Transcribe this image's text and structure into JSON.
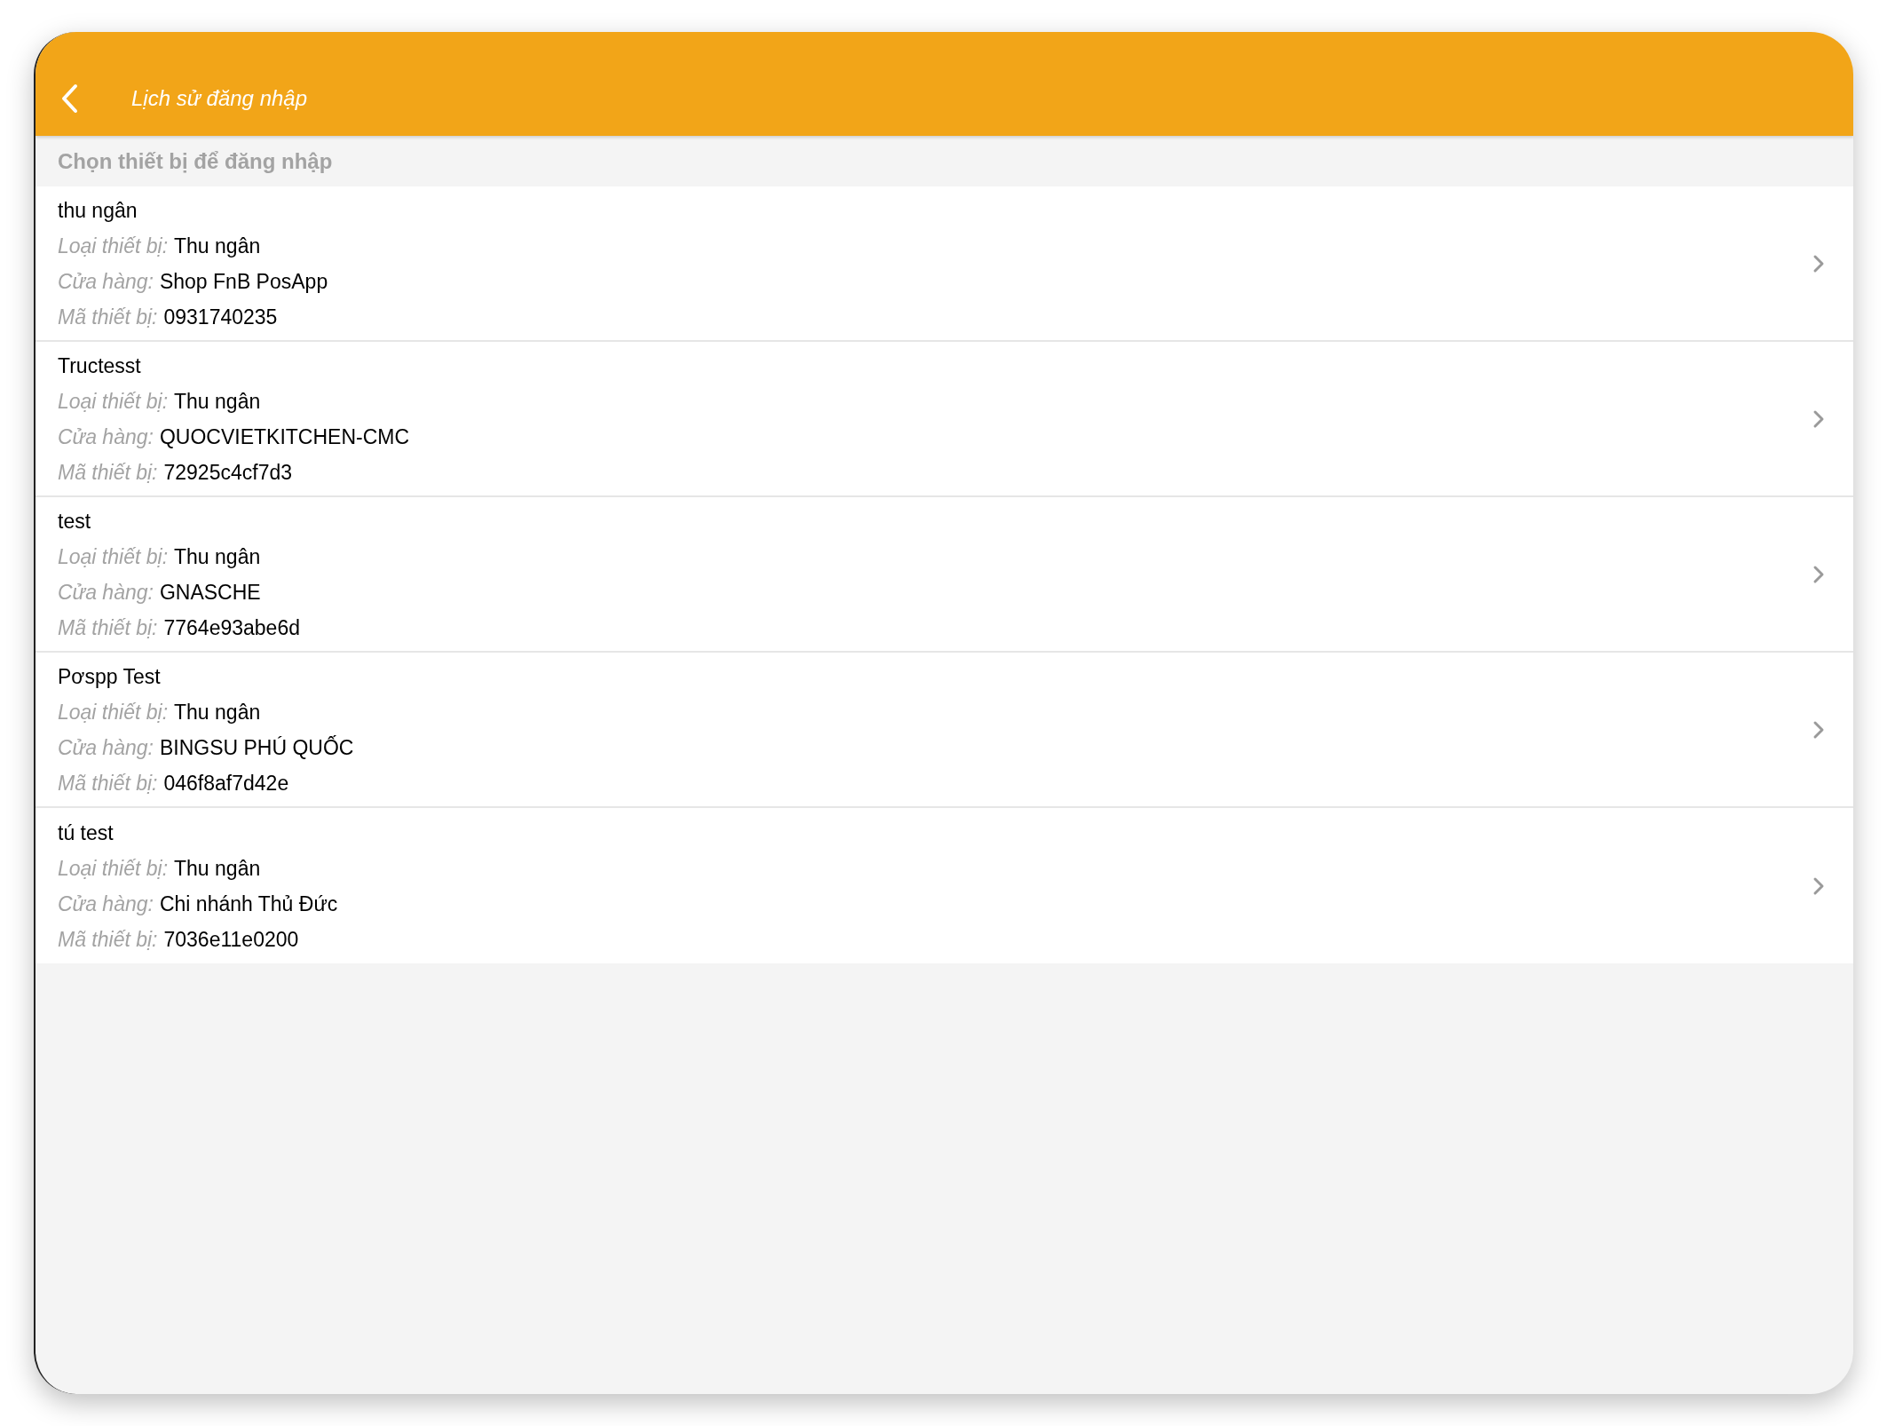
{
  "header": {
    "title": "Lịch sử đăng nhập"
  },
  "section": {
    "title": "Chọn thiết bị để đăng nhập"
  },
  "devices": [
    {
      "name": "thu ngân",
      "fields": [
        {
          "label": "Loại thiết bị:",
          "value": "Thu ngân"
        },
        {
          "label": "Cửa hàng:",
          "value": "Shop FnB PosApp"
        },
        {
          "label": "Mã thiết bị:",
          "value": "0931740235"
        }
      ]
    },
    {
      "name": "Tructesst",
      "fields": [
        {
          "label": "Loại thiết bị:",
          "value": "Thu ngân"
        },
        {
          "label": "Cửa hàng:",
          "value": "QUOCVIETKITCHEN-CMC"
        },
        {
          "label": "Mã thiết bị:",
          "value": "72925c4cf7d3"
        }
      ]
    },
    {
      "name": "test",
      "fields": [
        {
          "label": "Loại thiết bị:",
          "value": "Thu ngân"
        },
        {
          "label": "Cửa hàng:",
          "value": "GNASCHE"
        },
        {
          "label": "Mã thiết bị:",
          "value": "7764e93abe6d"
        }
      ]
    },
    {
      "name": "Pơspp Test",
      "fields": [
        {
          "label": "Loại thiết bị:",
          "value": "Thu ngân"
        },
        {
          "label": "Cửa hàng:",
          "value": "BINGSU PHÚ QUỐC"
        },
        {
          "label": "Mã thiết bị:",
          "value": "046f8af7d42e"
        }
      ]
    },
    {
      "name": "tú test",
      "fields": [
        {
          "label": "Loại thiết bị:",
          "value": "Thu ngân"
        },
        {
          "label": "Cửa hàng:",
          "value": "Chi nhánh Thủ Đức"
        },
        {
          "label": "Mã thiết bị:",
          "value": "7036e11e0200"
        }
      ]
    }
  ]
}
